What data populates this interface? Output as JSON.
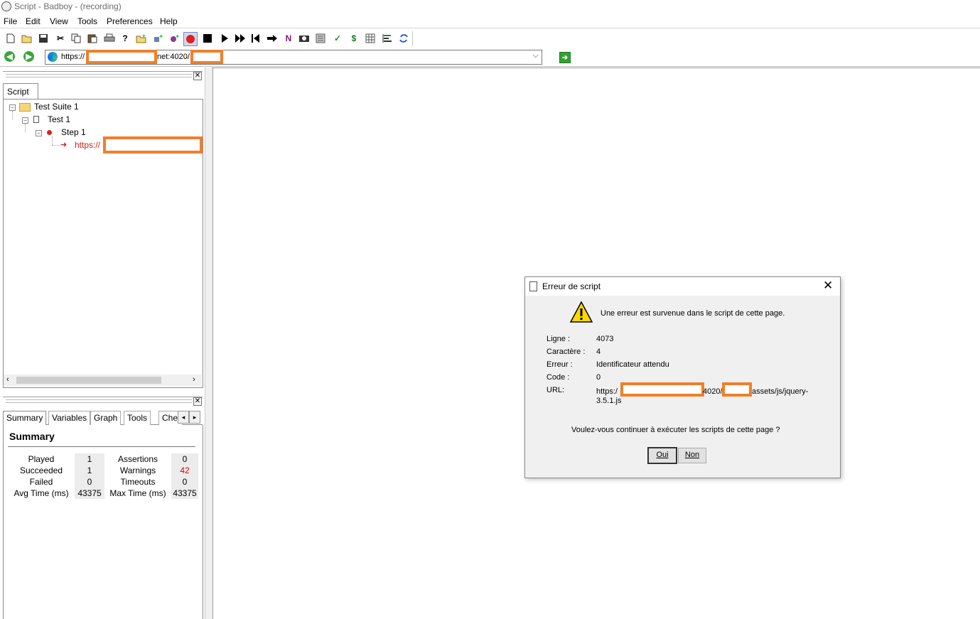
{
  "window": {
    "title": "Script - Badboy - (recording)"
  },
  "menu": [
    "File",
    "Edit",
    "View",
    "Tools",
    "Preferences",
    "Help"
  ],
  "toolbar": {
    "icons": [
      "new-icon",
      "open-icon",
      "save-icon",
      "cut-icon",
      "copy-icon",
      "paste-icon",
      "print-icon",
      "help-icon",
      "add-folder-icon",
      "add-step-icon",
      "add-item-icon",
      "record-icon",
      "stop-icon",
      "play-icon",
      "fast-forward-icon",
      "rewind-icon",
      "skip-icon",
      "n-icon",
      "camera-icon",
      "report-icon",
      "check-icon",
      "dollar-icon",
      "table-icon",
      "align-icon",
      "refresh-icon"
    ],
    "check_glyph": "✓",
    "dollar_glyph": "$",
    "n_glyph": "N"
  },
  "address": {
    "url_prefix": "https://",
    "url_mid": "net:4020/"
  },
  "script_panel": {
    "tab": "Script",
    "tree": {
      "suite": "Test Suite 1",
      "test": "Test 1",
      "step": "Step 1",
      "request": "https://"
    }
  },
  "summary_panel": {
    "tabs": [
      "Summary",
      "Variables",
      "Graph",
      "Tools",
      "Che"
    ],
    "heading": "Summary",
    "rows": [
      {
        "l1": "Played",
        "v1": "1",
        "l2": "Assertions",
        "v2": "0"
      },
      {
        "l1": "Succeeded",
        "v1": "1",
        "l2": "Warnings",
        "v2": "42"
      },
      {
        "l1": "Failed",
        "v1": "0",
        "l2": "Timeouts",
        "v2": "0"
      },
      {
        "l1": "Avg Time (ms)",
        "v1": "43375",
        "l2": "Max Time (ms)",
        "v2": "43375"
      }
    ],
    "warning_color": "#e00000"
  },
  "dialog": {
    "title": "Erreur de script",
    "message": "Une erreur est survenue dans le script de cette page.",
    "fields": [
      {
        "label": "Ligne :",
        "value": "4073"
      },
      {
        "label": "Caractère :",
        "value": "4"
      },
      {
        "label": "Erreur :",
        "value": "Identificateur attendu"
      },
      {
        "label": "Code :",
        "value": "0"
      }
    ],
    "url_label": "URL:",
    "url_start": "https:/",
    "url_port": "4020/",
    "url_path": "assets/js/jquery-",
    "url_path2": "3.5.1.js",
    "question": "Voulez-vous continuer à exécuter les scripts de cette page ?",
    "yes": "Oui",
    "no": "Non"
  },
  "colors": {
    "redaction": "#f07f2c",
    "record": "#e02020",
    "tree_request": "#d42020"
  }
}
